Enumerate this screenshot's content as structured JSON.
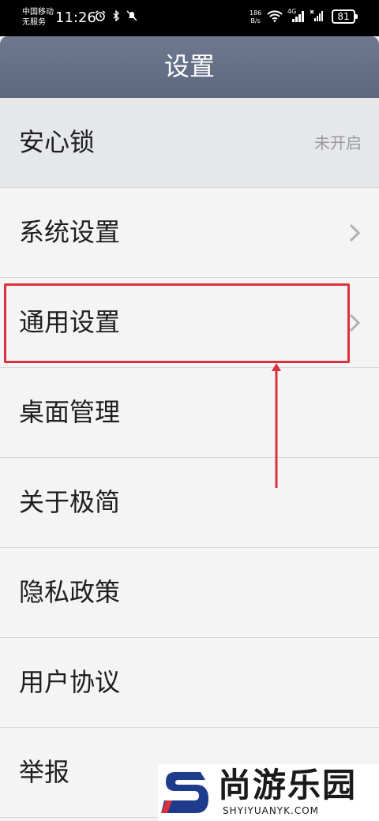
{
  "status_bar": {
    "carrier_line1": "中国移动",
    "carrier_line2": "无服务",
    "time": "11:26",
    "net_speed_value": "186",
    "net_speed_unit": "B/s",
    "network_type": "4G",
    "battery": "81"
  },
  "header": {
    "title": "设置"
  },
  "menu": {
    "items": [
      {
        "label": "安心锁",
        "value": "未开启"
      },
      {
        "label": "系统设置",
        "icon": "chevron-right-icon"
      },
      {
        "label": "通用设置",
        "icon": "chevron-right-icon"
      },
      {
        "label": "桌面管理"
      },
      {
        "label": "关于极简"
      },
      {
        "label": "隐私政策"
      },
      {
        "label": "用户协议"
      },
      {
        "label": "举报"
      }
    ]
  },
  "annotation": {
    "highlight_color": "#d9323c"
  },
  "watermark": {
    "name": "尚游乐园",
    "url": "SHYIYUANYK.COM"
  },
  "colors": {
    "header": "#626d83",
    "accent_red": "#d9323c",
    "watermark_blue": "#1f3b8c"
  }
}
